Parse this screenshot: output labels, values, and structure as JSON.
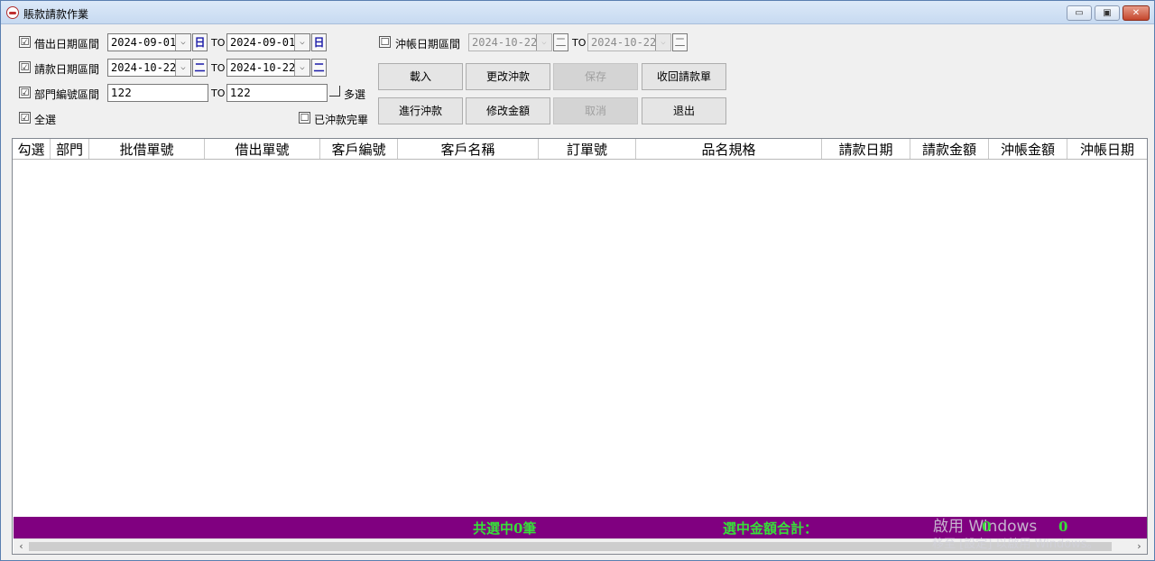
{
  "window": {
    "title": "賬款請款作業",
    "min_label": "▭",
    "max_label": "▣",
    "close_label": "✕"
  },
  "filters": {
    "loan_date": {
      "label": "借出日期區間",
      "checked": "☑",
      "from": "2024-09-01",
      "to_label": "TO",
      "to": "2024-09-01",
      "cal_glyph": "日"
    },
    "request_date": {
      "label": "請款日期區間",
      "checked": "☑",
      "from": "2024-10-22",
      "to_label": "TO",
      "to": "2024-10-22",
      "cal_glyph": "二"
    },
    "dept_no": {
      "label": "部門編號區間",
      "checked": "☑",
      "from": "122",
      "to_label": "TO",
      "to": "122",
      "multi_label": "多選"
    },
    "select_all": {
      "label": "全選",
      "checked": "☑"
    },
    "settled": {
      "label": "已沖款完畢",
      "checked": "☐"
    },
    "offset_date": {
      "label": "沖帳日期區間",
      "checked": "☐",
      "from": "2024-10-22",
      "to_label": "TO",
      "to": "2024-10-22",
      "cal_glyph": "二"
    },
    "dropdown_glyph": "⌵"
  },
  "buttons": {
    "load": "載入",
    "change_offset": "更改沖款",
    "save": "保存",
    "recall": "收回請款單",
    "do_offset": "進行沖款",
    "edit_amount": "修改金額",
    "cancel": "取消",
    "exit": "退出"
  },
  "grid": {
    "columns": [
      "勾選",
      "部門",
      "批借單號",
      "借出單號",
      "客戶編號",
      "客戶名稱",
      "訂單號",
      "品名規格",
      "請款日期",
      "請款金額",
      "沖帳金額",
      "沖帳日期"
    ]
  },
  "summary": {
    "count_text": "共選中0筆",
    "total_label": "選中金額合計：",
    "total_value_1": "0",
    "total_value_2": "0"
  },
  "watermark": {
    "line1": "啟用 Windows",
    "line2": "移至 [設定] 以啟用 Windows。"
  },
  "scroll": {
    "left_arrow": "‹",
    "right_arrow": "›"
  }
}
